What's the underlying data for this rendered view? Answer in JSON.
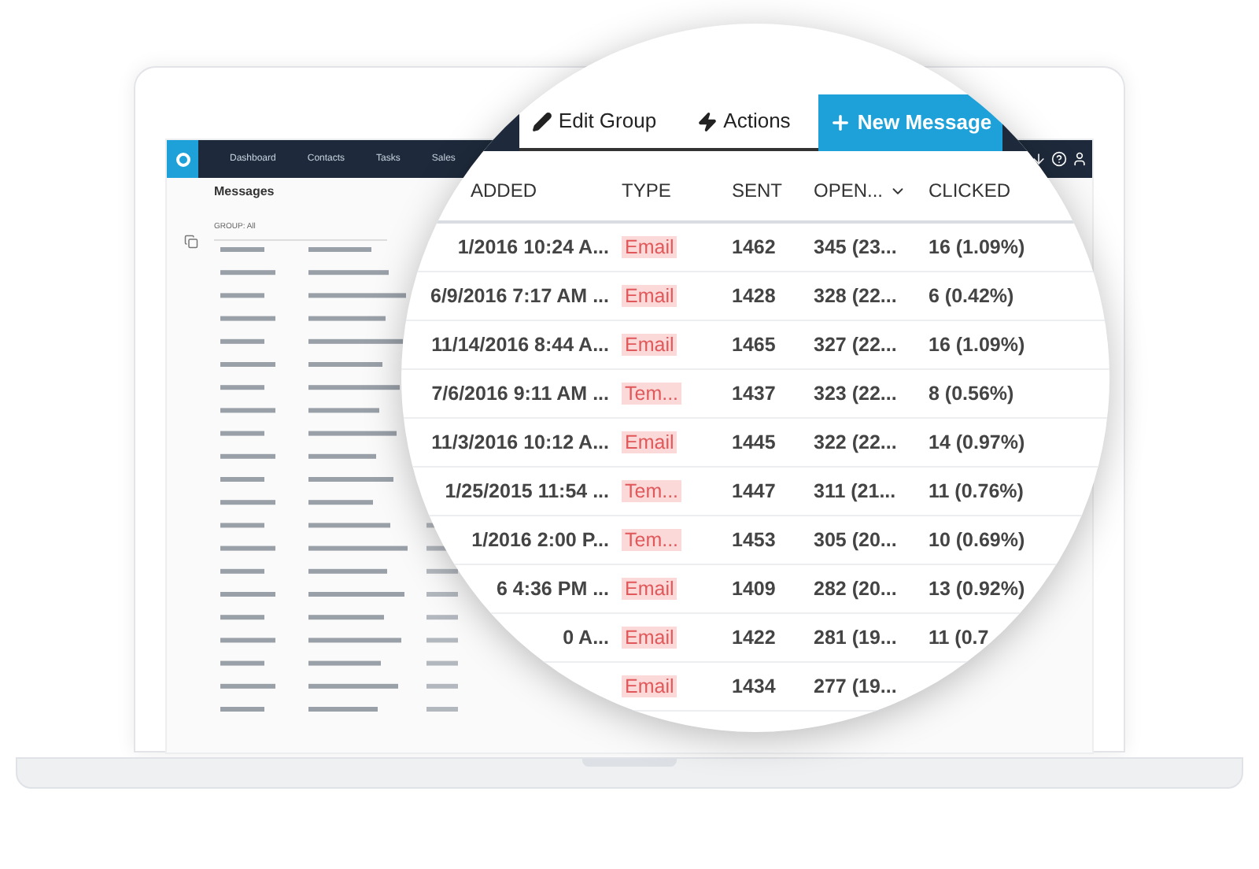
{
  "nav": {
    "items": [
      "Dashboard",
      "Contacts",
      "Tasks",
      "Sales"
    ]
  },
  "messages": {
    "title": "Messages",
    "group_label": "GROUP: All"
  },
  "toolbar": {
    "buttons": [
      {
        "label": "Edit Group",
        "kind": "edit"
      },
      {
        "label": "Actions",
        "kind": "actions"
      },
      {
        "label": "New Message",
        "kind": "primary"
      }
    ]
  },
  "table": {
    "columns": [
      {
        "label": "ADDED",
        "sorted": false
      },
      {
        "label": "TYPE",
        "sorted": false
      },
      {
        "label": "SENT",
        "sorted": false
      },
      {
        "label": "OPEN...",
        "sorted": true
      },
      {
        "label": "CLICKED",
        "sorted": false
      }
    ],
    "rows": [
      {
        "added": "1/2016 10:24 A...",
        "type": "Email",
        "sent": "1462",
        "opened": "345 (23...",
        "clicked": "16 (1.09%)"
      },
      {
        "added": "6/9/2016 7:17 AM ...",
        "type": "Email",
        "sent": "1428",
        "opened": "328 (22...",
        "clicked": "6 (0.42%)"
      },
      {
        "added": "11/14/2016 8:44 A...",
        "type": "Email",
        "sent": "1465",
        "opened": "327 (22...",
        "clicked": "16 (1.09%)"
      },
      {
        "added": "7/6/2016 9:11 AM ...",
        "type": "Tem...",
        "sent": "1437",
        "opened": "323 (22...",
        "clicked": "8 (0.56%)"
      },
      {
        "added": "11/3/2016 10:12 A...",
        "type": "Email",
        "sent": "1445",
        "opened": "322 (22...",
        "clicked": "14 (0.97%)"
      },
      {
        "added": "1/25/2015 11:54 ...",
        "type": "Tem...",
        "sent": "1447",
        "opened": "311 (21...",
        "clicked": "11 (0.76%)"
      },
      {
        "added": "1/2016 2:00 P...",
        "type": "Tem...",
        "sent": "1453",
        "opened": "305 (20...",
        "clicked": "10 (0.69%)"
      },
      {
        "added": "6 4:36 PM ...",
        "type": "Email",
        "sent": "1409",
        "opened": "282 (20...",
        "clicked": "13 (0.92%)"
      },
      {
        "added": "0 A...",
        "type": "Email",
        "sent": "1422",
        "opened": "281 (19...",
        "clicked": "11 (0.7"
      },
      {
        "type": "Email",
        "sent": "1434",
        "opened": "277 (19..."
      }
    ]
  }
}
